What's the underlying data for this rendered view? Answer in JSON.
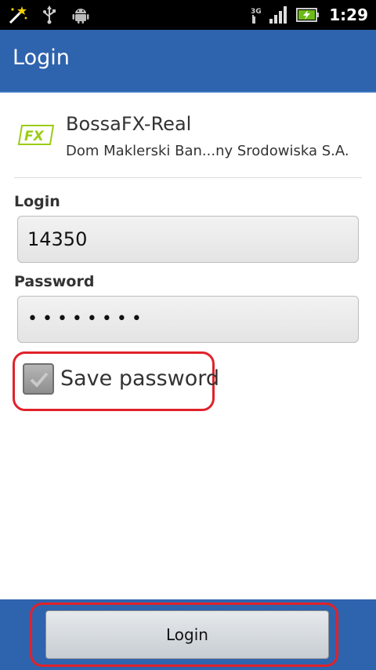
{
  "status_bar": {
    "time": "1:29",
    "network": "3G",
    "icons": [
      "wand-icon",
      "usb-icon",
      "android-icon",
      "3g-signal-icon",
      "battery-charging-icon"
    ]
  },
  "title_bar": {
    "title": "Login"
  },
  "broker": {
    "name": "BossaFX-Real",
    "company": "Dom Maklerski Ban...ny Srodowiska S.A.",
    "logo_text": "FX"
  },
  "form": {
    "login_label": "Login",
    "login_value": "14350",
    "password_label": "Password",
    "password_value": "••••••••",
    "save_password_label": "Save password",
    "save_password_checked": true
  },
  "actions": {
    "login_button": "Login"
  },
  "colors": {
    "title_bar": "#2e63ad",
    "highlight": "#e0222a",
    "logo": "#9ccc13"
  }
}
